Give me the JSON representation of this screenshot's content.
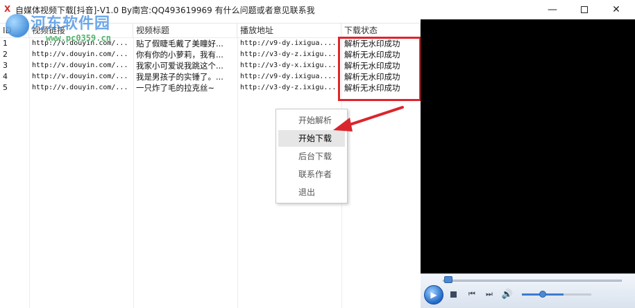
{
  "window": {
    "app_icon": "X",
    "title": "自媒体视频下载[抖音]-V1.0    By南宫:QQ493619969   有什么问题或者意见联系我",
    "icons": [
      "minimize-icon",
      "maximize-icon",
      "close-icon"
    ]
  },
  "watermark": {
    "name": "河东软件园",
    "url": "www.pc0359.cn"
  },
  "table": {
    "headers": {
      "index": "ID",
      "link": "视频链接",
      "title": "视频标题",
      "play": "播放地址",
      "status": "下载状态"
    },
    "rows": [
      {
        "index": "1",
        "link": "http://v.douyin.com/...",
        "title": "贴了假睫毛戴了美瞳好...",
        "play": "http://v9-dy.ixigua....",
        "status": "解析无水印成功"
      },
      {
        "index": "2",
        "link": "http://v.douyin.com/...",
        "title": "你有你的小萝莉，我有...",
        "play": "http://v3-dy-z.ixigu...",
        "status": "解析无水印成功"
      },
      {
        "index": "3",
        "link": "http://v.douyin.com/...",
        "title": "我家小可爱说我跳这个...",
        "play": "http://v3-dy-x.ixigu...",
        "status": "解析无水印成功"
      },
      {
        "index": "4",
        "link": "http://v.douyin.com/...",
        "title": "我是男孩子的实锤了。...",
        "play": "http://v9-dy.ixigua....",
        "status": "解析无水印成功"
      },
      {
        "index": "5",
        "link": "http://v.douyin.com/...",
        "title": "一只炸了毛的拉克丝~",
        "play": "http://v3-dy-z.ixigu...",
        "status": "解析无水印成功"
      }
    ]
  },
  "context_menu": {
    "items": [
      {
        "label": "开始解析",
        "active": false
      },
      {
        "label": "开始下载",
        "active": true
      },
      {
        "label": "后台下载",
        "active": false
      },
      {
        "label": "联系作者",
        "active": false
      },
      {
        "label": "退出",
        "active": false
      }
    ]
  },
  "player": {
    "icons": [
      "play-icon",
      "stop-icon",
      "previous-icon",
      "next-icon",
      "volume-icon"
    ],
    "seek_position": 0.02,
    "volume_level": 0.5
  },
  "colors": {
    "highlight": "#e0242b",
    "arrow": "#d9262c",
    "player_bg": "#000000"
  }
}
